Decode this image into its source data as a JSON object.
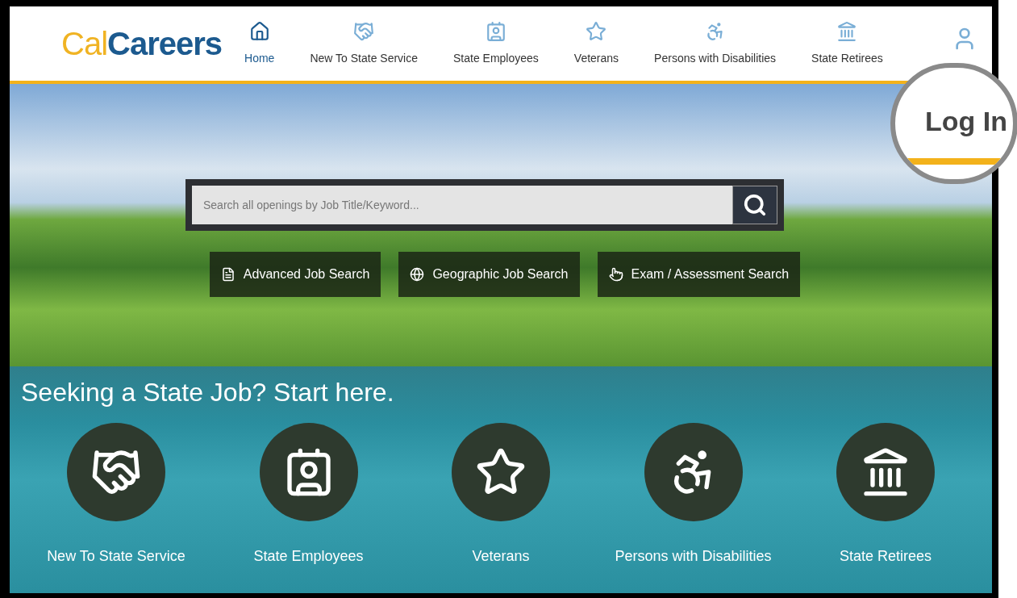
{
  "logo": {
    "part_1": "Cal",
    "part_2": "Careers"
  },
  "nav": [
    {
      "label": "Home",
      "selected": true
    },
    {
      "label": "New To State Service",
      "selected": false
    },
    {
      "label": "State Employees",
      "selected": false
    },
    {
      "label": "Veterans",
      "selected": false
    },
    {
      "label": "Persons with Disabilities",
      "selected": false
    },
    {
      "label": "State Retirees",
      "selected": false
    }
  ],
  "login_callout": {
    "label": "Log In"
  },
  "search": {
    "placeholder": "Search all openings by Job Title/Keyword..."
  },
  "quick_links": [
    "Advanced Job Search",
    "Geographic Job Search",
    "Exam / Assessment Search"
  ],
  "section": {
    "title": "Seeking a State Job? Start here.",
    "categories": [
      "New To State Service",
      "State Employees",
      "Veterans",
      "Persons with Disabilities",
      "State Retirees"
    ]
  }
}
